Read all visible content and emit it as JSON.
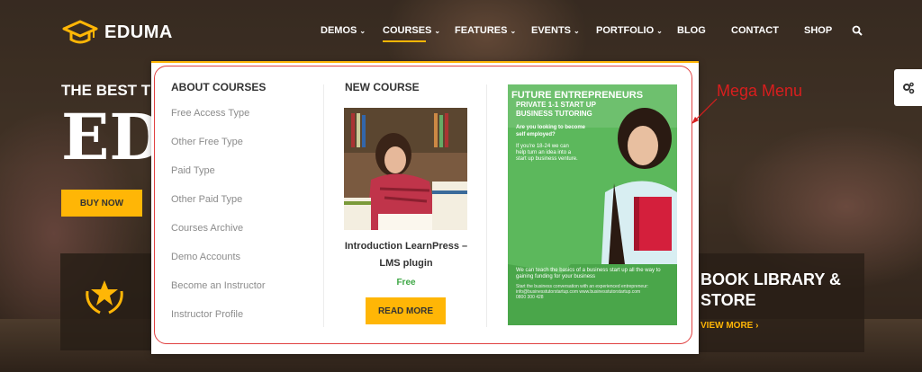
{
  "brand": {
    "name": "EDUMA"
  },
  "nav": {
    "items": [
      {
        "label": "DEMOS",
        "has_dropdown": true
      },
      {
        "label": "COURSES",
        "has_dropdown": true,
        "active": true
      },
      {
        "label": "FEATURES",
        "has_dropdown": true
      },
      {
        "label": "EVENTS",
        "has_dropdown": true
      },
      {
        "label": "PORTFOLIO",
        "has_dropdown": true
      },
      {
        "label": "BLOG",
        "has_dropdown": false
      },
      {
        "label": "CONTACT",
        "has_dropdown": false
      },
      {
        "label": "SHOP",
        "has_dropdown": false
      }
    ],
    "search_icon": "search-icon"
  },
  "hero": {
    "subtitle": "THE BEST T",
    "title": "ED",
    "button": "BUY NOW"
  },
  "mega_menu": {
    "about": {
      "title": "ABOUT COURSES",
      "items": [
        "Free Access Type",
        "Other Free Type",
        "Paid Type",
        "Other Paid Type",
        "Courses Archive",
        "Demo Accounts",
        "Become an Instructor",
        "Instructor Profile"
      ]
    },
    "new_course": {
      "title": "NEW COURSE",
      "course_name": "Introduction LearnPress – LMS plugin",
      "price": "Free",
      "button": "READ MORE"
    },
    "ad": {
      "headline1": "FUTURE ENTREPRENEURS",
      "headline2": "PRIVATE 1-1 START UP BUSINESS TUTORING",
      "question": "Are you looking to become self employed?",
      "paragraph": "If you're 18-24 we can help turn an idea into a start up business venture.",
      "bottom": "We can teach the basics of a business start up all the way to gaining funding for your business",
      "contact": "Start the business conversation with an experienced entrepreneur: info@businesstutorstartup.com www.businesstutorstartup.com 0800 300 428"
    }
  },
  "book_box": {
    "title": "BOOK LIBRARY & STORE",
    "link": "VIEW MORE"
  },
  "annotation": "Mega Menu",
  "colors": {
    "accent": "#ffb606",
    "price_green": "#3ea745",
    "ad_green": "#5cb85c",
    "annotation_red": "#d81e1e"
  }
}
